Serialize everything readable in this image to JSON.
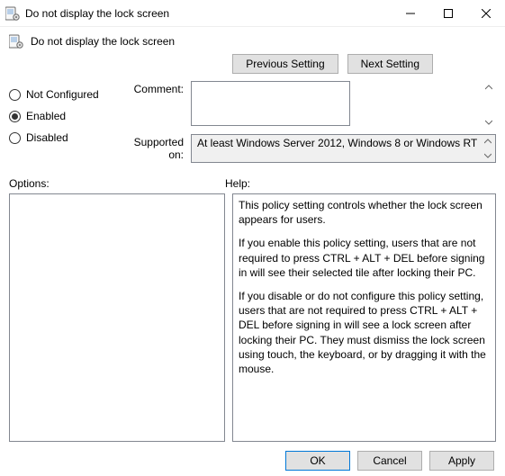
{
  "window": {
    "title": "Do not display the lock screen"
  },
  "header": {
    "title": "Do not display the lock screen"
  },
  "nav": {
    "previous": "Previous Setting",
    "next": "Next Setting"
  },
  "state": {
    "options": {
      "not_configured": "Not Configured",
      "enabled": "Enabled",
      "disabled": "Disabled"
    },
    "selected": "enabled"
  },
  "labels": {
    "comment": "Comment:",
    "supported_on": "Supported on:",
    "options": "Options:",
    "help": "Help:"
  },
  "comment": "",
  "supported_on": "At least Windows Server 2012, Windows 8 or Windows RT",
  "help": {
    "p1": "This policy setting controls whether the lock screen appears for users.",
    "p2": "If you enable this policy setting, users that are not required to press CTRL + ALT + DEL before signing in will see their selected tile after locking their PC.",
    "p3": "If you disable or do not configure this policy setting, users that are not required to press CTRL + ALT + DEL before signing in will see a lock screen after locking their PC. They must dismiss the lock screen using touch, the keyboard, or by dragging it with the mouse."
  },
  "buttons": {
    "ok": "OK",
    "cancel": "Cancel",
    "apply": "Apply"
  }
}
